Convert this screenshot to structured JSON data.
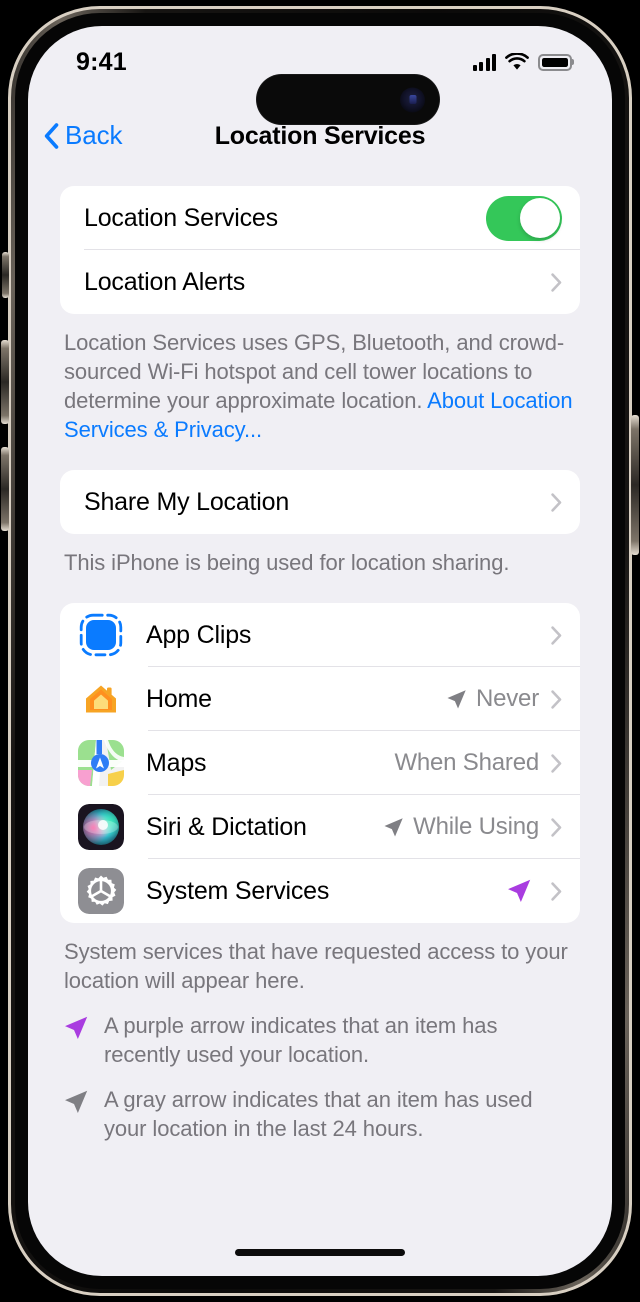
{
  "status_bar": {
    "time": "9:41",
    "cellular_icon": "cellular-bars-icon",
    "wifi_icon": "wifi-icon",
    "battery_icon": "battery-full-icon"
  },
  "nav": {
    "back_label": "Back",
    "title": "Location Services"
  },
  "colors": {
    "accent_blue": "#0a7bff",
    "toggle_green": "#34c759",
    "purple_arrow": "#a93ce0",
    "gray_arrow": "#7f7f84",
    "screen_bg": "#f0eff4",
    "card_bg": "#ffffff",
    "secondary_text": "#78767c"
  },
  "section_main": {
    "rows": [
      {
        "label": "Location Services",
        "control": "toggle",
        "toggle_on": true
      },
      {
        "label": "Location Alerts",
        "control": "chevron"
      }
    ],
    "footer": {
      "text": "Location Services uses GPS, Bluetooth, and crowd-sourced Wi-Fi hotspot and cell tower locations to determine your approximate location. ",
      "link": "About Location Services & Privacy..."
    }
  },
  "section_share": {
    "rows": [
      {
        "label": "Share My Location",
        "control": "chevron"
      }
    ],
    "footer": {
      "text": "This iPhone is being used for location sharing."
    }
  },
  "section_apps": {
    "rows": [
      {
        "label": "App Clips",
        "icon": "app-clips-icon",
        "value": "",
        "arrow": "none"
      },
      {
        "label": "Home",
        "icon": "home-app-icon",
        "value": "Never",
        "arrow": "gray"
      },
      {
        "label": "Maps",
        "icon": "maps-app-icon",
        "value": "When Shared",
        "arrow": "none"
      },
      {
        "label": "Siri & Dictation",
        "icon": "siri-app-icon",
        "value": "While Using",
        "arrow": "gray"
      },
      {
        "label": "System Services",
        "icon": "system-services-icon",
        "value": "",
        "arrow": "purple"
      }
    ],
    "footer": {
      "text": "System services that have requested access to your location will appear here."
    },
    "legend": [
      {
        "arrow": "purple",
        "text": "A purple arrow indicates that an item has recently used your location."
      },
      {
        "arrow": "gray",
        "text": "A gray arrow indicates that an item has used your location in the last 24 hours."
      }
    ]
  }
}
